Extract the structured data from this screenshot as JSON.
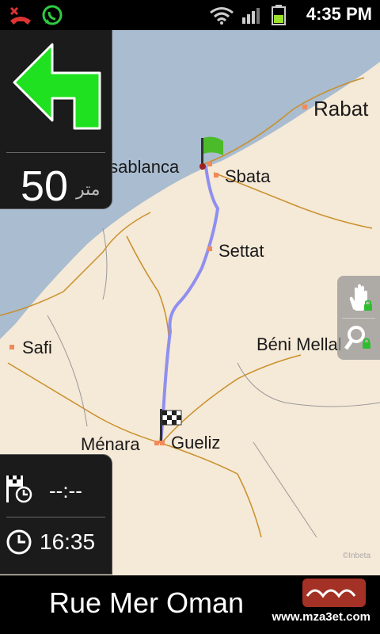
{
  "status_bar": {
    "time": "4:35 PM",
    "icons": [
      "missed-call-icon",
      "whatsapp-icon",
      "wifi-icon",
      "signal-icon",
      "battery-icon"
    ]
  },
  "navigation": {
    "maneuver_icon": "turn-left-arrow-icon",
    "distance_value": "50",
    "distance_unit": "متر",
    "eta_remaining": "--:--",
    "current_time": "16:35",
    "street_name": "Rue Mer Oman",
    "route_color": "#8f8ff0",
    "maneuver_color": "#1fe11f"
  },
  "map": {
    "cities": [
      {
        "name": "Rabat"
      },
      {
        "name": "Casablanca"
      },
      {
        "name": "Sbata"
      },
      {
        "name": "Settat"
      },
      {
        "name": "Safi"
      },
      {
        "name": "Béni Mellal"
      },
      {
        "name": "Ménara"
      },
      {
        "name": "Gueliz"
      }
    ],
    "start_marker": "green-flag-icon",
    "end_marker": "checkered-flag-icon",
    "copyright": "©Inbeta"
  },
  "controls": {
    "pan_lock": "hand-lock-icon",
    "zoom_lock": "magnifier-lock-icon"
  },
  "watermark": {
    "site": "www.mza3et.com"
  }
}
